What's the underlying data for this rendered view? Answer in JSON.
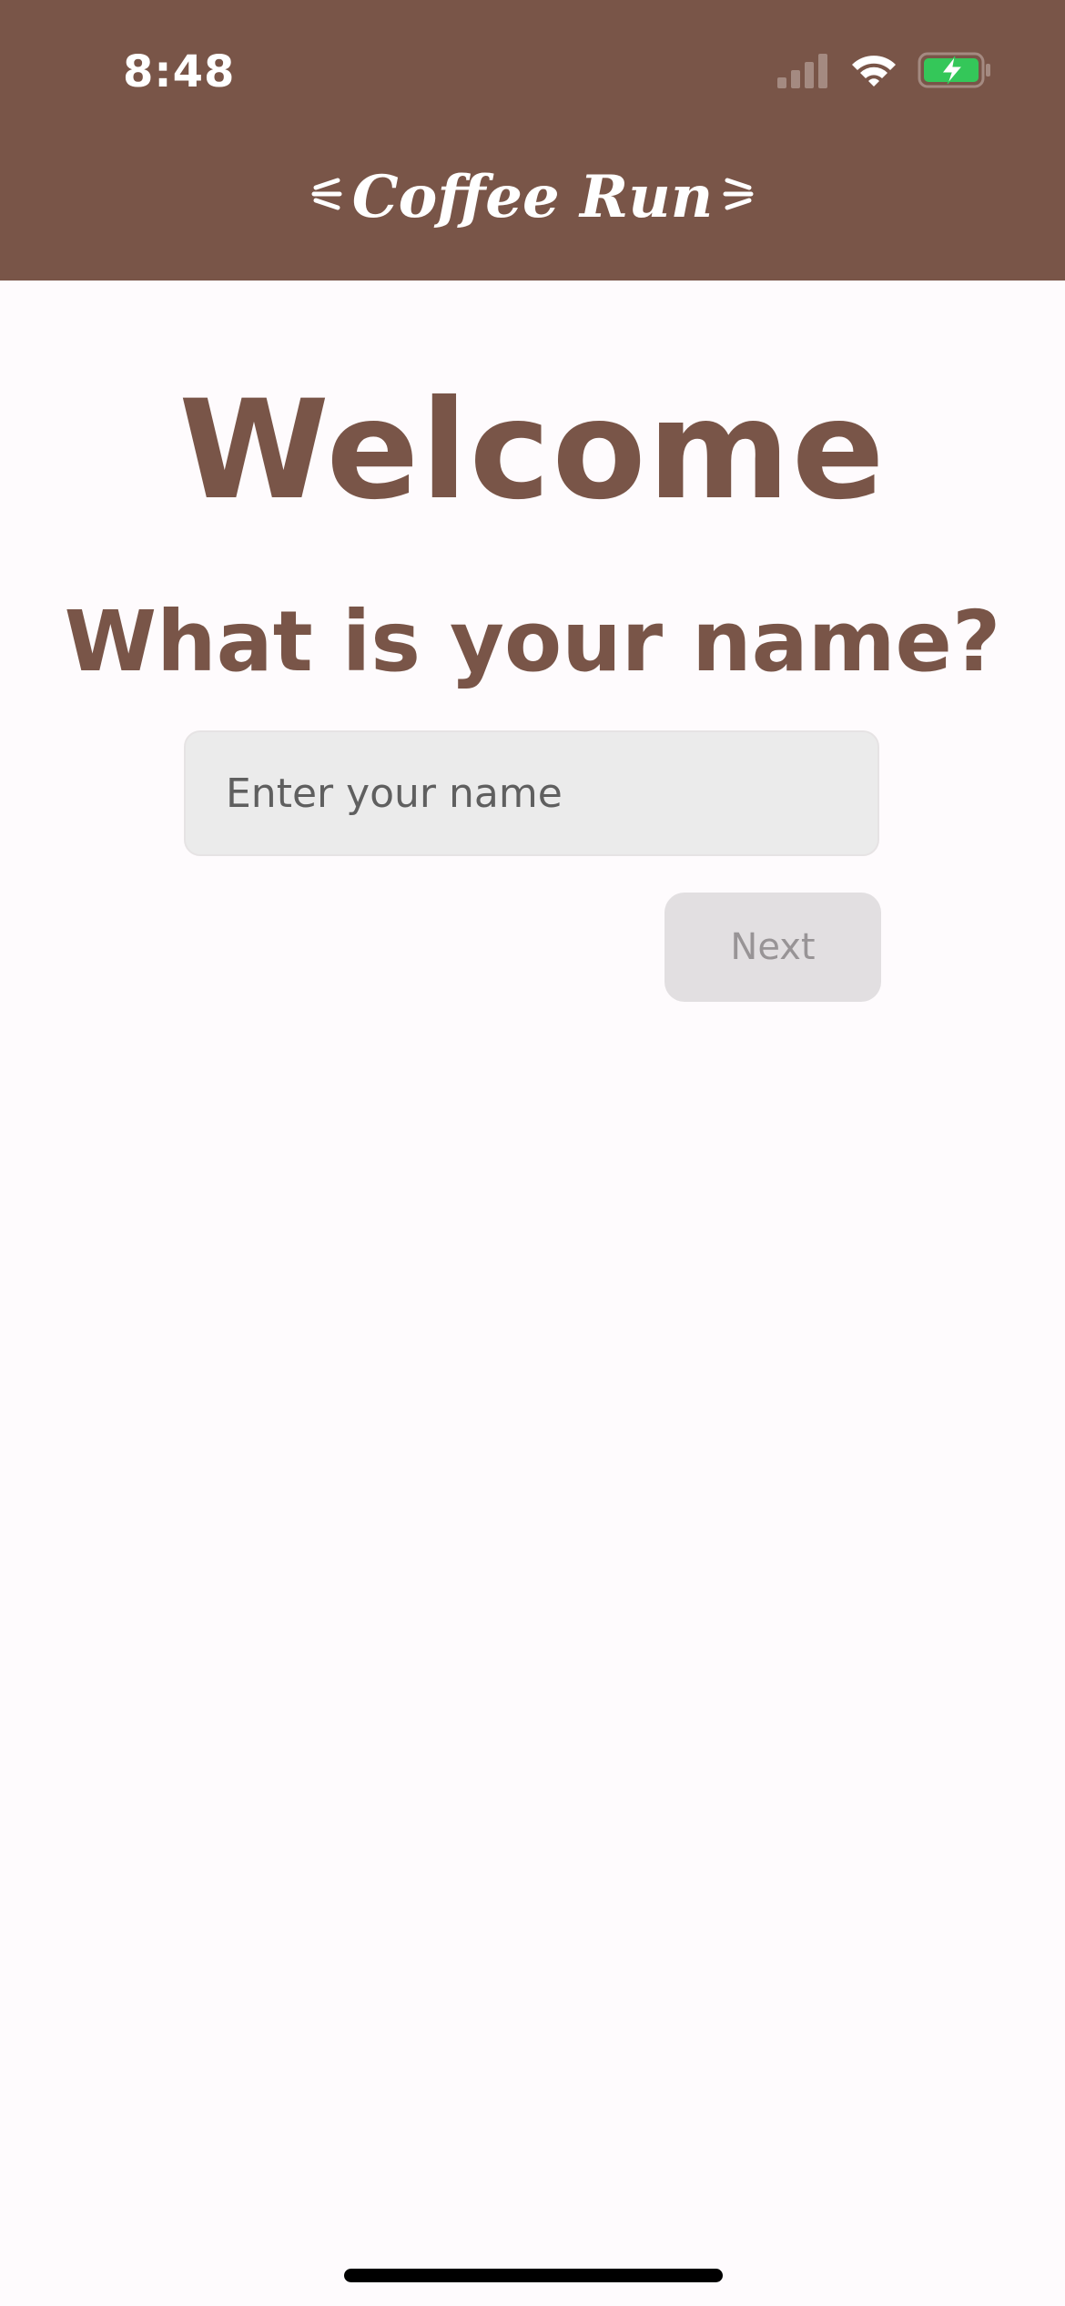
{
  "status_bar": {
    "time": "8:48",
    "icons": [
      "cellular-signal-icon",
      "wifi-icon",
      "battery-charging-icon"
    ]
  },
  "header": {
    "title": "Coffee Run",
    "decorations": [
      "left-sparkle-icon",
      "right-sparkle-icon"
    ]
  },
  "main": {
    "welcome": "Welcome",
    "question": "What is your name?",
    "name_input": {
      "placeholder": "Enter your name",
      "value": ""
    },
    "next_label": "Next"
  },
  "colors": {
    "brand_brown": "#795548",
    "background": "#fefbfd",
    "input_bg": "#ebebeb",
    "button_disabled_bg": "#e2dfe1",
    "battery_green": "#34c759"
  }
}
